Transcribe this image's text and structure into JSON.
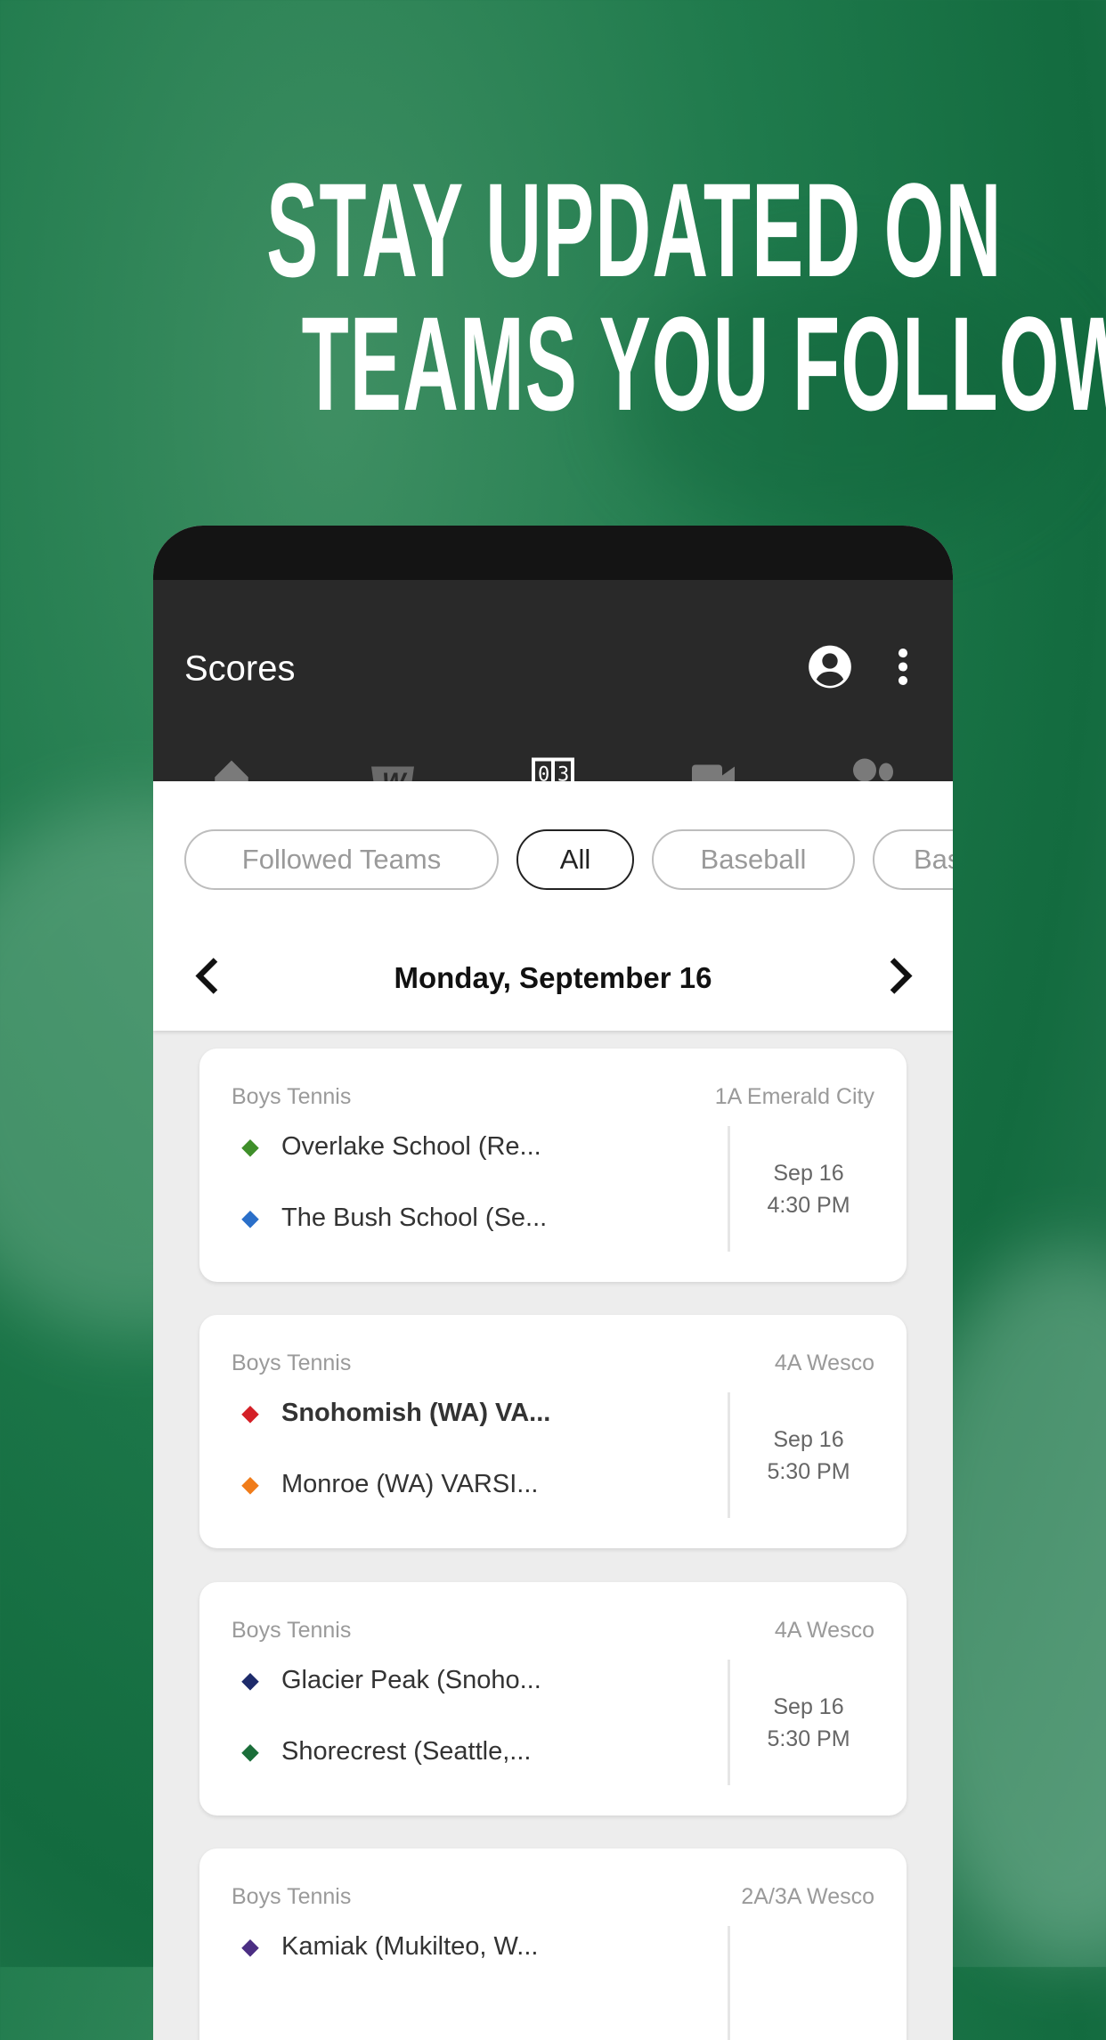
{
  "headline": {
    "line1": "STAY UPDATED ON",
    "line2": "TEAMS YOU FOLLOW"
  },
  "appbar": {
    "title": "Scores",
    "icons": [
      "account-circle-icon",
      "more-vert-icon"
    ]
  },
  "tabs": [
    {
      "icon": "home-icon"
    },
    {
      "icon": "wiaa-logo-icon"
    },
    {
      "icon": "scoreboard-icon",
      "selected": true
    },
    {
      "icon": "video-camera-icon"
    },
    {
      "icon": "sports-balls-icon"
    }
  ],
  "filters": [
    {
      "label": "Followed Teams"
    },
    {
      "label": "All",
      "selected": true
    },
    {
      "label": "Baseball"
    },
    {
      "label": "Bas"
    }
  ],
  "date_nav": {
    "date": "Monday, September 16"
  },
  "games": [
    {
      "sport": "Boys Tennis",
      "league": "1A Emerald City",
      "team1": "Overlake School (Re...",
      "team2": "The Bush School (Se...",
      "date": "Sep 16",
      "time": "4:30 PM",
      "logo1_color": "#3f8f2a",
      "logo2_color": "#2a6fc9"
    },
    {
      "sport": "Boys Tennis",
      "league": "4A Wesco",
      "team1": "Snohomish (WA) VA...",
      "team2": "Monroe (WA) VARSI...",
      "date": "Sep 16",
      "time": "5:30 PM",
      "team1_bold": true,
      "logo1_color": "#d42027",
      "logo2_color": "#f07c1a"
    },
    {
      "sport": "Boys Tennis",
      "league": "4A Wesco",
      "team1": "Glacier Peak (Snoho...",
      "team2": "Shorecrest (Seattle,...",
      "date": "Sep 16",
      "time": "5:30 PM",
      "logo1_color": "#1e2b6b",
      "logo2_color": "#1b6e3a"
    },
    {
      "sport": "Boys Tennis",
      "league": "2A/3A Wesco",
      "team1": "Kamiak (Mukilteo, W...",
      "logo1_color": "#4b2e83"
    }
  ]
}
